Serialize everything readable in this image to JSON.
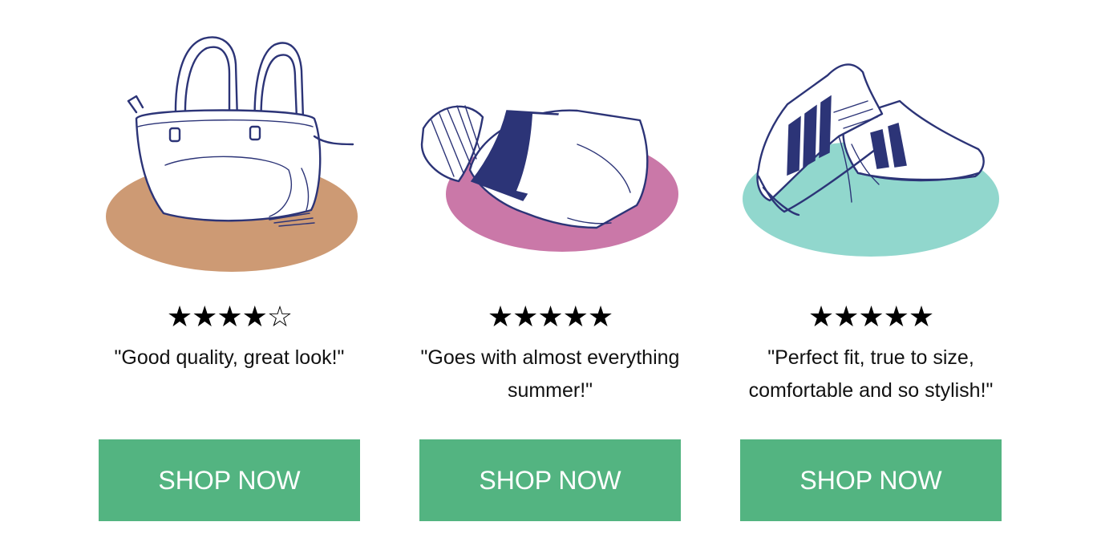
{
  "products": [
    {
      "illustration": "handbag-icon",
      "blob_color": "#cd9a74",
      "stars": "★★★★☆",
      "rating": 4,
      "quote": "\"Good quality, great look!\"",
      "button": "SHOP NOW"
    },
    {
      "illustration": "folded-sweater-icon",
      "blob_color": "#ca78a8",
      "stars": "★★★★★",
      "rating": 5,
      "quote": "\"Goes with almost everything summer!\"",
      "button": "SHOP NOW"
    },
    {
      "illustration": "sneakers-icon",
      "blob_color": "#91d7cd",
      "stars": "★★★★★",
      "rating": 5,
      "quote": "\"Perfect fit, true to size, comfortable and so stylish!\"",
      "button": "SHOP NOW"
    }
  ],
  "colors": {
    "button_bg": "#53b481",
    "button_text": "#ffffff",
    "ink": "#2c3477"
  }
}
